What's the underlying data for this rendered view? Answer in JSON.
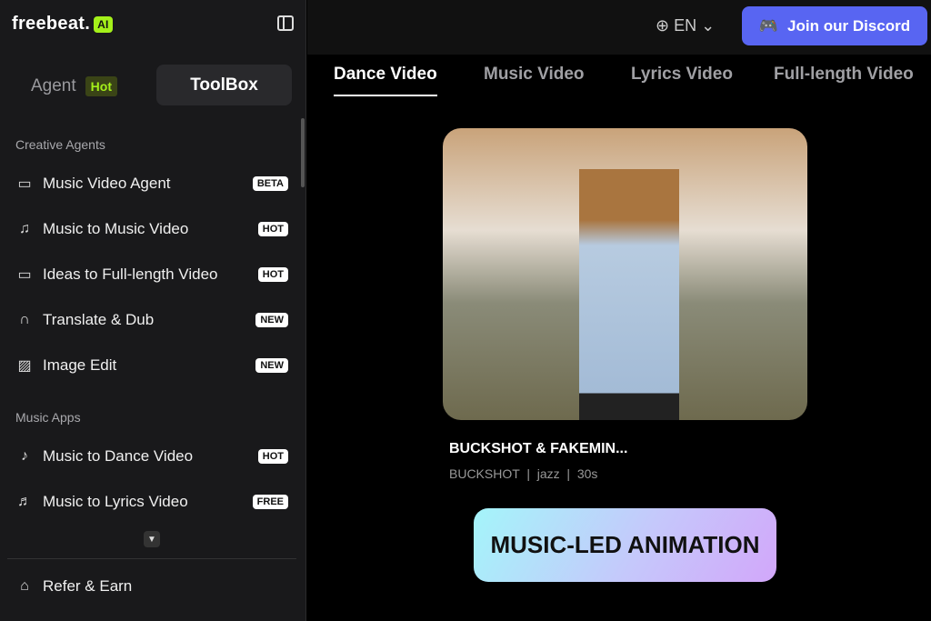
{
  "logo": {
    "text": "freebeat.",
    "badge": "AI"
  },
  "sidebar": {
    "agent_label": "Agent",
    "agent_badge": "Hot",
    "toolbox_label": "ToolBox",
    "sections": [
      "Creative Agents",
      "Music Apps"
    ],
    "creative": [
      {
        "label": "Music Video Agent",
        "badge": "BETA",
        "icon": "chat-code-icon"
      },
      {
        "label": "Music to Music Video",
        "badge": "HOT",
        "icon": "music-note-icon"
      },
      {
        "label": "Ideas to Full-length Video",
        "badge": "HOT",
        "icon": "video-camera-icon"
      },
      {
        "label": "Translate & Dub",
        "badge": "NEW",
        "icon": "speaking-head-icon"
      },
      {
        "label": "Image Edit",
        "badge": "NEW",
        "icon": "image-plus-icon"
      }
    ],
    "music": [
      {
        "label": "Music to Dance Video",
        "badge": "HOT",
        "icon": "music-note-icon"
      },
      {
        "label": "Music to Lyrics Video",
        "badge": "FREE",
        "icon": "music-file-icon"
      }
    ],
    "refer": "Refer & Earn"
  },
  "header": {
    "lang": "EN",
    "discord": "Join our Discord"
  },
  "tabs": [
    "Dance Video",
    "Music Video",
    "Lyrics Video",
    "Full-length Video"
  ],
  "card": {
    "title": "BUCKSHOT & FAKEMIN...",
    "meta": "BUCKSHOT  |  jazz  |  30s"
  },
  "banner": "MUSIC-LED ANIMATION"
}
